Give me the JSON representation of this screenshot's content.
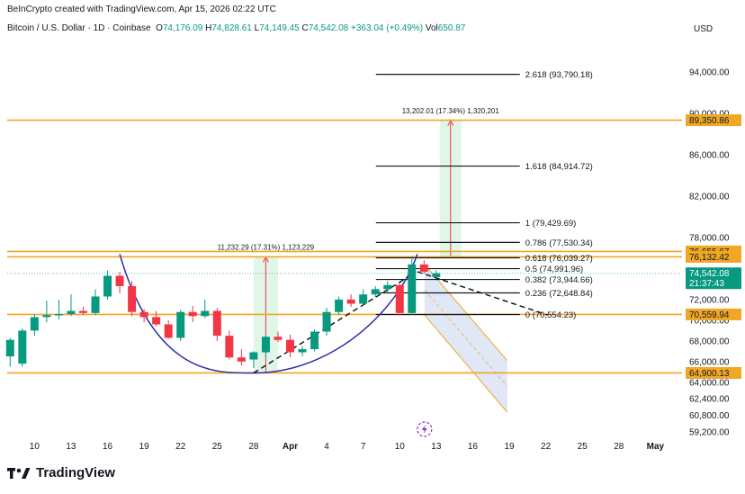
{
  "header": {
    "text": "BeInCrypto created with TradingView.com, Apr 15, 2026 02:22 UTC"
  },
  "symbol": {
    "name": "Bitcoin / U.S. Dollar · 1D · Coinbase",
    "o_label": "O",
    "o": "74,176.09",
    "h_label": "H",
    "h": "74,828.61",
    "l_label": "L",
    "l": "74,149.45",
    "c_label": "C",
    "c": "74,542.08",
    "change": "+363.04 (+0.49%)",
    "vol_label": "Vol",
    "vol": "650.87"
  },
  "currency": "USD",
  "brand": "TradingView",
  "colors": {
    "up": "#089981",
    "down": "#f23645",
    "level": "#f0a726",
    "curve": "#2e2ea8",
    "channel": "#c6d4f1"
  },
  "chart_data": {
    "type": "candlestick",
    "title": "Bitcoin / U.S. Dollar · 1D · Coinbase",
    "y_axis": {
      "label": "USD",
      "range": [
        58500,
        97500
      ],
      "ticks": [
        "94,000.00",
        "90,000.00",
        "86,000.00",
        "82,000.00",
        "78,000.00",
        "72,000.00",
        "70,000.00",
        "68,000.00",
        "66,000.00",
        "64,000.00",
        "62,400.00",
        "60,800.00",
        "59,200.00"
      ]
    },
    "x_axis": {
      "ticks": [
        "10",
        "13",
        "16",
        "19",
        "22",
        "25",
        "28",
        "Apr",
        "4",
        "7",
        "10",
        "13",
        "16",
        "19",
        "22",
        "25",
        "28",
        "May"
      ]
    },
    "candles": [
      {
        "o": 66500,
        "h": 68300,
        "l": 65500,
        "c": 68100
      },
      {
        "o": 65800,
        "h": 69200,
        "l": 65500,
        "c": 69000
      },
      {
        "o": 69000,
        "h": 70600,
        "l": 68500,
        "c": 70300
      },
      {
        "o": 70300,
        "h": 71900,
        "l": 69800,
        "c": 70500
      },
      {
        "o": 70500,
        "h": 72000,
        "l": 70100,
        "c": 70600
      },
      {
        "o": 70600,
        "h": 72500,
        "l": 70400,
        "c": 70900
      },
      {
        "o": 70900,
        "h": 71300,
        "l": 70500,
        "c": 70700
      },
      {
        "o": 70700,
        "h": 73000,
        "l": 70500,
        "c": 72300
      },
      {
        "o": 72300,
        "h": 74800,
        "l": 72000,
        "c": 74300
      },
      {
        "o": 74300,
        "h": 74700,
        "l": 72600,
        "c": 73300
      },
      {
        "o": 73300,
        "h": 73800,
        "l": 70400,
        "c": 70800
      },
      {
        "o": 70800,
        "h": 71100,
        "l": 69800,
        "c": 70300
      },
      {
        "o": 70300,
        "h": 70900,
        "l": 69400,
        "c": 69600
      },
      {
        "o": 69600,
        "h": 70000,
        "l": 68200,
        "c": 68300
      },
      {
        "o": 68300,
        "h": 71000,
        "l": 68000,
        "c": 70800
      },
      {
        "o": 70800,
        "h": 71400,
        "l": 69800,
        "c": 70400
      },
      {
        "o": 70400,
        "h": 72000,
        "l": 70200,
        "c": 70900
      },
      {
        "o": 70900,
        "h": 71200,
        "l": 68000,
        "c": 68500
      },
      {
        "o": 68500,
        "h": 69000,
        "l": 66200,
        "c": 66400
      },
      {
        "o": 66400,
        "h": 67200,
        "l": 65600,
        "c": 66000
      },
      {
        "o": 66200,
        "h": 67000,
        "l": 65400,
        "c": 66900
      },
      {
        "o": 66900,
        "h": 68500,
        "l": 66500,
        "c": 68400
      },
      {
        "o": 68400,
        "h": 68900,
        "l": 67900,
        "c": 68100
      },
      {
        "o": 68100,
        "h": 68600,
        "l": 66400,
        "c": 66900
      },
      {
        "o": 66900,
        "h": 67500,
        "l": 66500,
        "c": 67200
      },
      {
        "o": 67200,
        "h": 69100,
        "l": 67000,
        "c": 68900
      },
      {
        "o": 68900,
        "h": 71200,
        "l": 68500,
        "c": 70800
      },
      {
        "o": 70800,
        "h": 72300,
        "l": 70500,
        "c": 72000
      },
      {
        "o": 72000,
        "h": 72500,
        "l": 71300,
        "c": 71600
      },
      {
        "o": 71600,
        "h": 73000,
        "l": 71400,
        "c": 72500
      },
      {
        "o": 72500,
        "h": 73300,
        "l": 72200,
        "c": 73000
      },
      {
        "o": 73000,
        "h": 73800,
        "l": 72700,
        "c": 73400
      },
      {
        "o": 73400,
        "h": 73600,
        "l": 70500,
        "c": 70700
      },
      {
        "o": 70700,
        "h": 76200,
        "l": 70500,
        "c": 75400
      },
      {
        "o": 75400,
        "h": 75800,
        "l": 74500,
        "c": 74700
      },
      {
        "o": 74176.09,
        "h": 74828.61,
        "l": 74149.45,
        "c": 74542.08
      }
    ],
    "fibonacci": [
      {
        "ratio": "2.618",
        "price": 93790.18
      },
      {
        "ratio": "1.618",
        "price": 84914.72
      },
      {
        "ratio": "1",
        "price": 79429.69
      },
      {
        "ratio": "0.786",
        "price": 77530.34
      },
      {
        "ratio": "0.618",
        "price": 76039.27
      },
      {
        "ratio": "0.5",
        "price": 74991.96
      },
      {
        "ratio": "0.382",
        "price": 73944.66
      },
      {
        "ratio": "0.236",
        "price": 72648.84
      },
      {
        "ratio": "0",
        "price": 70554.23
      }
    ],
    "horizontal_levels": [
      {
        "price": 89350.86,
        "label": "89,350.86"
      },
      {
        "price": 76655.67,
        "label": "76,655.67"
      },
      {
        "price": 76132.42,
        "label": "76,132.42"
      },
      {
        "price": 70559.94,
        "label": "70,559.94"
      },
      {
        "price": 64900.13,
        "label": "64,900.13"
      }
    ],
    "last_price": {
      "price": 74542.08,
      "label": "74,542.08",
      "countdown": "21:37:43"
    },
    "measures": [
      {
        "label": "11,232.29 (17.31%) 1,123,229",
        "from": 64900,
        "to": 76132
      },
      {
        "label": "13,202.01 (17.34%) 1,320,201",
        "from": 76132,
        "to": 89334
      }
    ],
    "channel": {
      "upper_start": 75400,
      "upper_end": 66100,
      "lower_start": 70500,
      "lower_end": 61100
    },
    "trendline": {
      "from": 64900,
      "to": 70800
    }
  }
}
